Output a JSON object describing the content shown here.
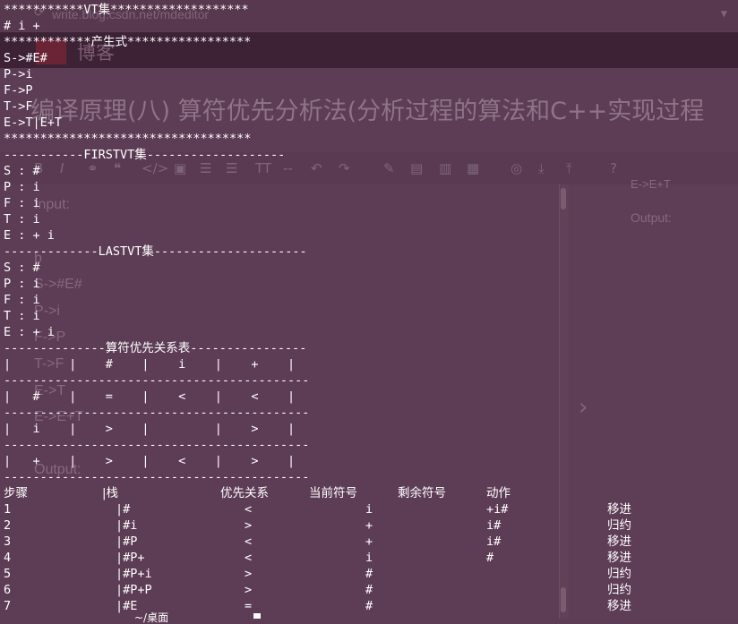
{
  "background": {
    "url": "write.blog.csdn.net/mdeditor",
    "blog_label": "博客",
    "article_title": "编译原理(八) 算符优先分析法(分析过程的算法和C++实现过程",
    "editor_text": [
      "Input:",
      "b",
      "S->#E#",
      "P->i",
      "F->P",
      "T->F",
      "E->T",
      "E->E+T",
      "Output:"
    ],
    "right_pane_text": [
      "E->E+T",
      "Output:"
    ],
    "toolbar_icons": [
      "bold-icon",
      "italic-icon",
      "link-icon",
      "quote-icon",
      "code-icon",
      "image-icon",
      "ordered-list-icon",
      "unordered-list-icon",
      "heading-icon",
      "hr-icon",
      "undo-icon",
      "edit-icon",
      "save-icon",
      "doc-icon",
      "publish-icon",
      "globe-icon",
      "download-icon",
      "upload-icon",
      "help-icon"
    ]
  },
  "terminal": {
    "vt_header": "***********VT集*******************",
    "vt_set": "# i +",
    "production_header": "************产生式*****************",
    "productions": [
      "S->#E#",
      "P->i",
      "F->P",
      "T->F",
      "E->T|E+T"
    ],
    "production_footer": "**********************************",
    "firstvt_header": "-----------FIRSTVT集-------------------",
    "firstvt": [
      "S : #",
      "P : i",
      "F : i",
      "T : i",
      "E : + i"
    ],
    "lastvt_header": "-------------LASTVT集---------------------",
    "lastvt": [
      "S : #",
      "P : i",
      "F : i",
      "T : i",
      "E : + i"
    ],
    "table_header": "--------------算符优先关系表----------------",
    "table_rows": [
      "|        |    #    |    i    |    +    |",
      "------------------------------------------",
      "|   #    |    =    |    <    |    <    |",
      "------------------------------------------",
      "|   i    |    >    |         |    >    |",
      "------------------------------------------",
      "|   +    |    >    |    <    |    >    |",
      "------------------------------------------"
    ],
    "steps_columns": [
      "步骤",
      "|栈",
      "优先关系",
      "当前符号",
      "剩余符号",
      "动作"
    ],
    "steps": [
      {
        "step": "1",
        "stack": "|#",
        "relation": "<",
        "current": "i",
        "remaining": "+i#",
        "action": "移进"
      },
      {
        "step": "2",
        "stack": "|#i",
        "relation": ">",
        "current": "+",
        "remaining": "i#",
        "action": "归约"
      },
      {
        "step": "3",
        "stack": "|#P",
        "relation": "<",
        "current": "+",
        "remaining": "i#",
        "action": "移进"
      },
      {
        "step": "4",
        "stack": "|#P+",
        "relation": "<",
        "current": "i",
        "remaining": "#",
        "action": "移进"
      },
      {
        "step": "5",
        "stack": "|#P+i",
        "relation": ">",
        "current": "#",
        "remaining": "",
        "action": "归约"
      },
      {
        "step": "6",
        "stack": "|#P+P",
        "relation": ">",
        "current": "#",
        "remaining": "",
        "action": "归约"
      },
      {
        "step": "7",
        "stack": "|#E",
        "relation": "=",
        "current": "#",
        "remaining": "",
        "action": "移进"
      }
    ],
    "prompt_partial": "~/桌面"
  },
  "colors": {
    "terminal_bg": "#5d3c55",
    "header_bar": "#3d2236",
    "text": "#ffffff"
  }
}
